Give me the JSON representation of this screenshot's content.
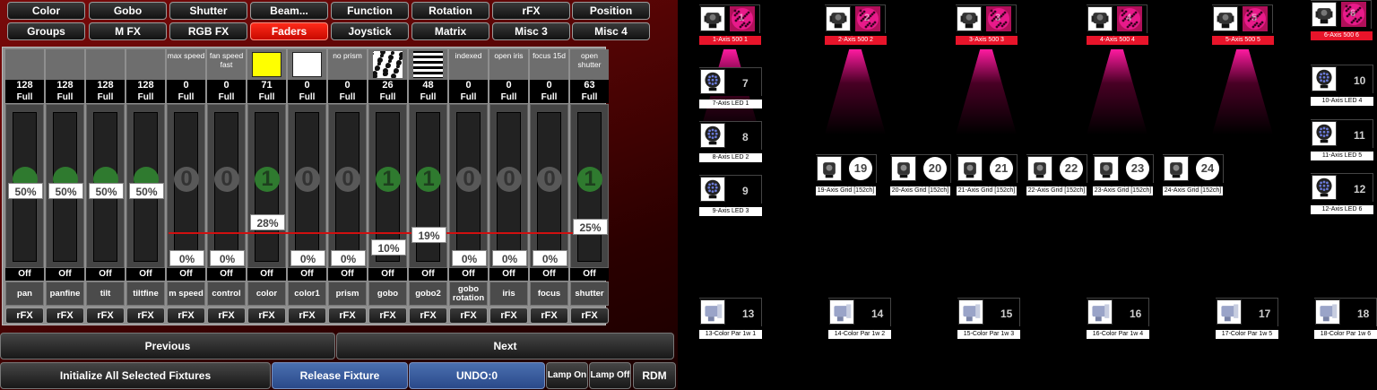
{
  "tabs_row1": [
    {
      "label": "Color",
      "active": false
    },
    {
      "label": "Gobo",
      "active": false
    },
    {
      "label": "Shutter",
      "active": false
    },
    {
      "label": "Beam...",
      "active": false
    },
    {
      "label": "Function",
      "active": false
    },
    {
      "label": "Rotation",
      "active": false
    },
    {
      "label": "rFX",
      "active": false
    },
    {
      "label": "Position",
      "active": false
    }
  ],
  "tabs_row2": [
    {
      "label": "Groups",
      "active": false
    },
    {
      "label": "M FX",
      "active": false
    },
    {
      "label": "RGB FX",
      "active": false
    },
    {
      "label": "Faders",
      "active": true
    },
    {
      "label": "Joystick",
      "active": false
    },
    {
      "label": "Matrix",
      "active": false
    },
    {
      "label": "Misc 3",
      "active": false
    },
    {
      "label": "Misc 4",
      "active": false
    }
  ],
  "faders": [
    {
      "header": "",
      "header_swatch": "",
      "value": "128",
      "full": "Full",
      "knob": "",
      "knob_color": "green",
      "knob_pct": 0.5,
      "percent": "50%",
      "off": "Off",
      "name": "pan",
      "rfx": "rFX"
    },
    {
      "header": "",
      "header_swatch": "",
      "value": "128",
      "full": "Full",
      "knob": "",
      "knob_color": "green",
      "knob_pct": 0.5,
      "percent": "50%",
      "off": "Off",
      "name": "panfine",
      "rfx": "rFX"
    },
    {
      "header": "",
      "header_swatch": "",
      "value": "128",
      "full": "Full",
      "knob": "",
      "knob_color": "green",
      "knob_pct": 0.5,
      "percent": "50%",
      "off": "Off",
      "name": "tilt",
      "rfx": "rFX"
    },
    {
      "header": "",
      "header_swatch": "",
      "value": "128",
      "full": "Full",
      "knob": "",
      "knob_color": "green",
      "knob_pct": 0.5,
      "percent": "50%",
      "off": "Off",
      "name": "tiltfine",
      "rfx": "rFX"
    },
    {
      "header": "max speed",
      "header_swatch": "",
      "value": "0",
      "full": "Full",
      "knob": "0",
      "knob_color": "gray",
      "knob_pct": 0,
      "percent": "0%",
      "off": "Off",
      "name": "m speed",
      "rfx": "rFX"
    },
    {
      "header": "fan speed fast",
      "header_swatch": "",
      "value": "0",
      "full": "Full",
      "knob": "0",
      "knob_color": "gray",
      "knob_pct": 0,
      "percent": "0%",
      "off": "Off",
      "name": "control",
      "rfx": "rFX"
    },
    {
      "header": "",
      "header_swatch": "#ffff00",
      "value": "71",
      "full": "Full",
      "knob": "1",
      "knob_color": "green",
      "knob_pct": 0.28,
      "percent": "28%",
      "off": "Off",
      "name": "color",
      "rfx": "rFX"
    },
    {
      "header": "",
      "header_swatch": "#ffffff",
      "value": "0",
      "full": "Full",
      "knob": "0",
      "knob_color": "gray",
      "knob_pct": 0,
      "percent": "0%",
      "off": "Off",
      "name": "color1",
      "rfx": "rFX"
    },
    {
      "header": "no prism",
      "header_swatch": "",
      "value": "0",
      "full": "Full",
      "knob": "0",
      "knob_color": "gray",
      "knob_pct": 0,
      "percent": "0%",
      "off": "Off",
      "name": "prism",
      "rfx": "rFX"
    },
    {
      "header": "",
      "header_swatch": "gobo-pattern",
      "value": "26",
      "full": "Full",
      "knob": "1",
      "knob_color": "green",
      "knob_pct": 0.1,
      "percent": "10%",
      "off": "Off",
      "name": "gobo",
      "rfx": "rFX"
    },
    {
      "header": "",
      "header_swatch": "stripes-pattern",
      "value": "48",
      "full": "Full",
      "knob": "1",
      "knob_color": "green",
      "knob_pct": 0.19,
      "percent": "19%",
      "off": "Off",
      "name": "gobo2",
      "rfx": "rFX"
    },
    {
      "header": "indexed",
      "header_swatch": "",
      "value": "0",
      "full": "Full",
      "knob": "0",
      "knob_color": "gray",
      "knob_pct": 0,
      "percent": "0%",
      "off": "Off",
      "name": "gobo rotation",
      "rfx": "rFX"
    },
    {
      "header": "open iris",
      "header_swatch": "",
      "value": "0",
      "full": "Full",
      "knob": "0",
      "knob_color": "gray",
      "knob_pct": 0,
      "percent": "0%",
      "off": "Off",
      "name": "iris",
      "rfx": "rFX"
    },
    {
      "header": "focus 15d",
      "header_swatch": "",
      "value": "0",
      "full": "Full",
      "knob": "0",
      "knob_color": "gray",
      "knob_pct": 0,
      "percent": "0%",
      "off": "Off",
      "name": "focus",
      "rfx": "rFX"
    },
    {
      "header": "open shutter",
      "header_swatch": "",
      "value": "63",
      "full": "Full",
      "knob": "1",
      "knob_color": "green",
      "knob_pct": 0.25,
      "percent": "25%",
      "off": "Off",
      "name": "shutter",
      "rfx": "rFX"
    }
  ],
  "nav": {
    "previous": "Previous",
    "next": "Next"
  },
  "actions": {
    "initialize": "Initialize All Selected Fixtures",
    "release": "Release Fixture",
    "undo": "UNDO:0",
    "lamp_on": "Lamp On",
    "lamp_off": "Lamp Off",
    "rdm": "RDM"
  },
  "colors": {
    "active_tab": "#e8140a",
    "selected_fixture": "#e8142a",
    "beam": "#ff1aa0",
    "blue_button": "#3a5fa0"
  },
  "fixtures": [
    {
      "number": "1",
      "label": "1-Axis 500 1",
      "type": "moving-head-spot",
      "selected": true,
      "beam": true,
      "num_style": "gobo"
    },
    {
      "number": "2",
      "label": "2-Axis 500 2",
      "type": "moving-head-spot",
      "selected": true,
      "beam": true,
      "num_style": "gobo"
    },
    {
      "number": "3",
      "label": "3-Axis 500 3",
      "type": "moving-head-spot",
      "selected": true,
      "beam": true,
      "num_style": "gobo"
    },
    {
      "number": "4",
      "label": "4-Axis 500 4",
      "type": "moving-head-spot",
      "selected": true,
      "beam": true,
      "num_style": "gobo"
    },
    {
      "number": "5",
      "label": "5-Axis 500 5",
      "type": "moving-head-spot",
      "selected": true,
      "beam": true,
      "num_style": "gobo"
    },
    {
      "number": "6",
      "label": "6-Axis 500 6",
      "type": "moving-head-spot",
      "selected": true,
      "beam": false,
      "num_style": "gobo"
    },
    {
      "number": "7",
      "label": "7-Axis LED 1",
      "type": "led-wash",
      "selected": false,
      "num_style": "plain"
    },
    {
      "number": "8",
      "label": "8-Axis LED 2",
      "type": "led-wash",
      "selected": false,
      "num_style": "plain"
    },
    {
      "number": "9",
      "label": "9-Axis LED 3",
      "type": "led-wash",
      "selected": false,
      "num_style": "plain"
    },
    {
      "number": "10",
      "label": "10-Axis LED 4",
      "type": "led-wash",
      "selected": false,
      "num_style": "plain"
    },
    {
      "number": "11",
      "label": "11-Axis LED 5",
      "type": "led-wash",
      "selected": false,
      "num_style": "plain"
    },
    {
      "number": "12",
      "label": "12-Axis LED 6",
      "type": "led-wash",
      "selected": false,
      "num_style": "plain"
    },
    {
      "number": "13",
      "label": "13-Color Par 1w 1",
      "type": "par-can",
      "selected": false,
      "num_style": "plain"
    },
    {
      "number": "14",
      "label": "14-Color Par 1w 2",
      "type": "par-can",
      "selected": false,
      "num_style": "plain"
    },
    {
      "number": "15",
      "label": "15-Color Par 1w 3",
      "type": "par-can",
      "selected": false,
      "num_style": "plain"
    },
    {
      "number": "16",
      "label": "16-Color Par 1w 4",
      "type": "par-can",
      "selected": false,
      "num_style": "plain"
    },
    {
      "number": "17",
      "label": "17-Color Par 1w 5",
      "type": "par-can",
      "selected": false,
      "num_style": "plain"
    },
    {
      "number": "18",
      "label": "18-Color Par 1w 6",
      "type": "par-can",
      "selected": false,
      "num_style": "plain"
    },
    {
      "number": "19",
      "label": "19-Axis Grid [152ch]",
      "type": "grid-spot",
      "selected": false,
      "num_style": "circle"
    },
    {
      "number": "20",
      "label": "20-Axis Grid [152ch]",
      "type": "grid-spot",
      "selected": false,
      "num_style": "circle"
    },
    {
      "number": "21",
      "label": "21-Axis Grid [152ch]",
      "type": "grid-spot",
      "selected": false,
      "num_style": "circle"
    },
    {
      "number": "22",
      "label": "22-Axis Grid [152ch]",
      "type": "grid-spot",
      "selected": false,
      "num_style": "circle"
    },
    {
      "number": "23",
      "label": "23-Axis Grid [152ch]",
      "type": "grid-spot",
      "selected": false,
      "num_style": "circle"
    },
    {
      "number": "24",
      "label": "24-Axis Grid [152ch]",
      "type": "grid-spot",
      "selected": false,
      "num_style": "circle"
    }
  ]
}
